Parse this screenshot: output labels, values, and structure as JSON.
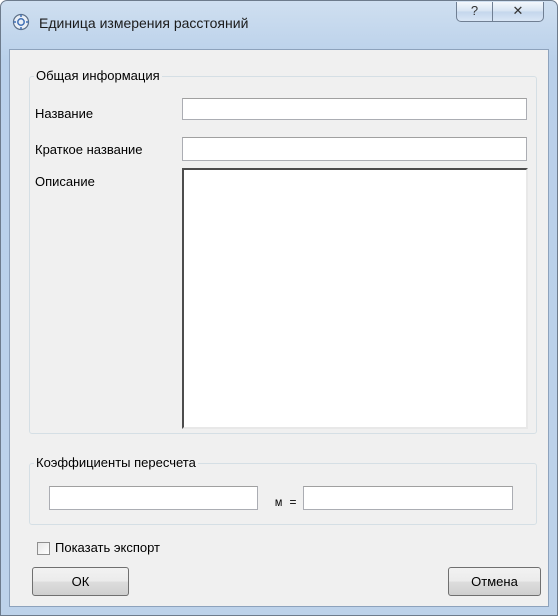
{
  "window": {
    "title": "Единица измерения расстояний",
    "icon": "gear-icon",
    "help_label": "?",
    "close_label": "✕"
  },
  "general_group": {
    "legend": "Общая информация",
    "name_label": "Название",
    "name_value": "",
    "short_name_label": "Краткое название",
    "short_name_value": "",
    "description_label": "Описание",
    "description_value": ""
  },
  "conversion_group": {
    "legend": "Коэффициенты пересчета",
    "left_value": "",
    "unit_equals": "м =",
    "right_value": ""
  },
  "show_export": {
    "label": "Показать экспорт",
    "checked": false
  },
  "buttons": {
    "ok_label": "ОК",
    "cancel_label": "Отмена"
  }
}
